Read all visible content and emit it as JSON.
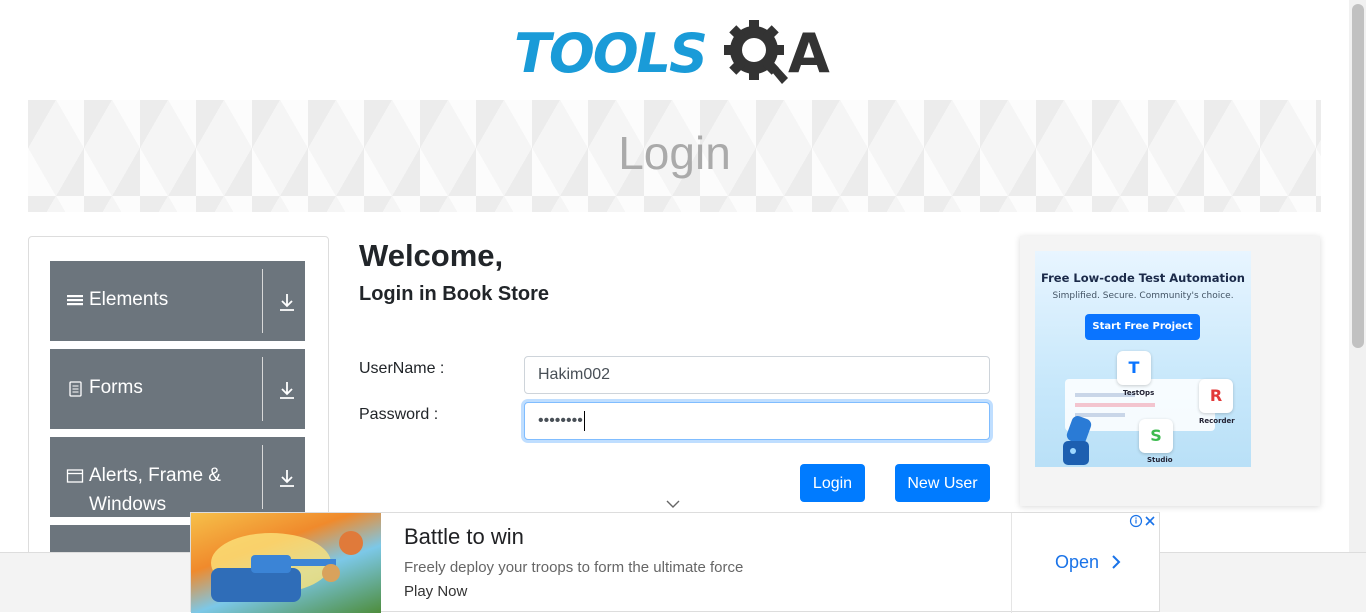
{
  "logo": {
    "text": "TOOLS",
    "letter": "A",
    "icon": "gear-q-icon"
  },
  "banner": {
    "title": "Login"
  },
  "sidebar": {
    "groups": [
      {
        "label": "Elements",
        "icon": "hamburger-icon"
      },
      {
        "label": "Forms",
        "icon": "document-icon"
      },
      {
        "label": "Alerts, Frame & Windows",
        "icon": "window-icon"
      }
    ]
  },
  "main": {
    "welcome": "Welcome,",
    "subtitle": "Login in Book Store",
    "username_label": "UserName :",
    "username_value": "Hakim002",
    "password_label": "Password :",
    "password_value": "••••••••",
    "login_button": "Login",
    "new_user_button": "New User"
  },
  "side_ad": {
    "title": "Free Low-code Test Automation",
    "subtitle": "Simplified. Secure. Community's choice.",
    "cta": "Start Free Project",
    "products": [
      "TestOps",
      "Recorder",
      "Studio"
    ]
  },
  "bottom_ad": {
    "title": "Battle to win",
    "description": "Freely deploy your troops to form the ultimate force",
    "play": "Play Now",
    "open": "Open"
  },
  "colors": {
    "primary": "#007bff",
    "sidebar": "#6c757d",
    "logo_blue": "#1a9bd8"
  }
}
